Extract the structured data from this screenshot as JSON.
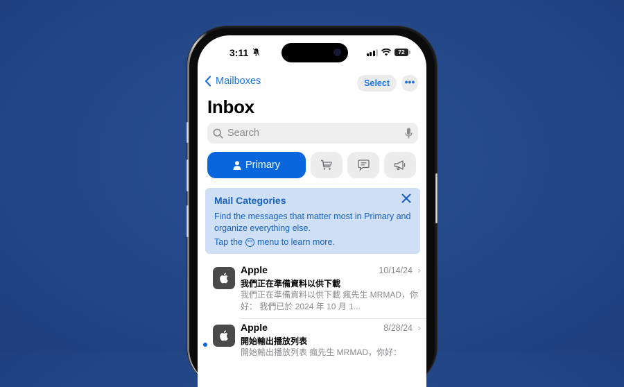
{
  "status_bar": {
    "time": "3:11",
    "silent_icon": "bell-slash-icon",
    "battery": "72"
  },
  "nav": {
    "back_label": "Mailboxes",
    "select_label": "Select",
    "more_label": "•••"
  },
  "page": {
    "title": "Inbox"
  },
  "search": {
    "placeholder": "Search",
    "value": ""
  },
  "categories": {
    "primary_label": "Primary",
    "items": [
      {
        "name": "primary",
        "icon": "person-icon",
        "selected": true
      },
      {
        "name": "transactions",
        "icon": "cart-icon",
        "selected": false
      },
      {
        "name": "updates",
        "icon": "message-icon",
        "selected": false
      },
      {
        "name": "promotions",
        "icon": "megaphone-icon",
        "selected": false
      }
    ]
  },
  "banner": {
    "title": "Mail Categories",
    "body": "Find the messages that matter most in Primary and organize everything else.",
    "tip_before": "Tap the",
    "tip_after": "menu to learn more.",
    "tip_icon": "•••"
  },
  "messages": [
    {
      "sender": "Apple",
      "date": "10/14/24",
      "subject": "我們正在準備資料以供下載",
      "preview": "我們正在準備資料以供下載 瘋先生 MRMAD，你好： 我們已於 2024 年 10 月 1...",
      "unread": false
    },
    {
      "sender": "Apple",
      "date": "8/28/24",
      "subject": "開始輸出播放列表",
      "preview": "開始輸出播放列表 瘋先生 MRMAD，你好：",
      "unread": true
    }
  ],
  "colors": {
    "accent": "#1a73e8",
    "primary_tab": "#0a66dc",
    "banner_bg": "#cfe0f6",
    "background": "#244889"
  }
}
